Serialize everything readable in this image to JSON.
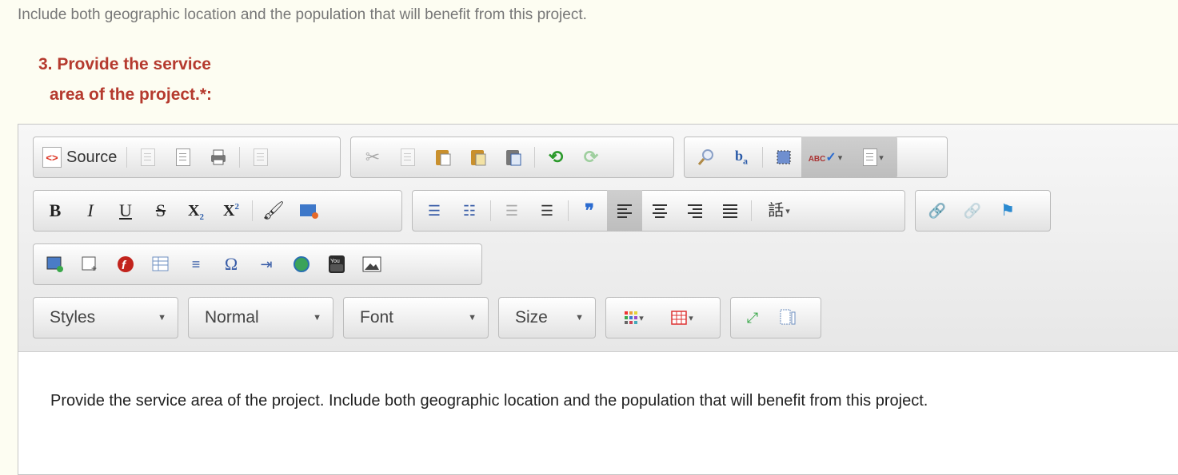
{
  "instruction": "Include both geographic location and the population that will benefit from this project.",
  "question": {
    "line1": "3. Provide the service",
    "line2": "area of the project.*:"
  },
  "toolbar": {
    "source_label": "Source",
    "combos": {
      "styles": "Styles",
      "format": "Normal",
      "font": "Font",
      "size": "Size"
    },
    "glyphs": {
      "bold": "B",
      "italic": "I",
      "underline": "U",
      "strike": "S",
      "subscript": "X",
      "superscript": "X",
      "omega": "Ω",
      "blockquote": "❞"
    }
  },
  "content": {
    "text": "Provide the service area of the project. Include both geographic location and the population that will benefit from this project."
  },
  "colors": {
    "question": "#b53a2e",
    "instruction": "#777777",
    "page_bg": "#fdfdf2"
  }
}
